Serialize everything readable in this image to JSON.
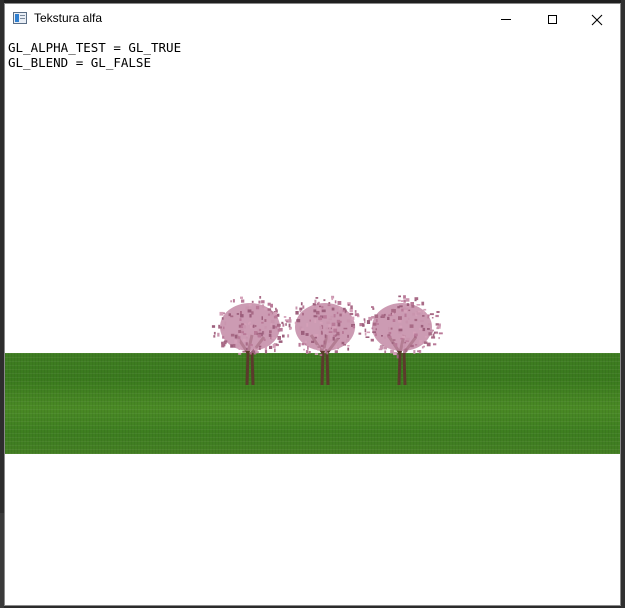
{
  "window": {
    "title": "Tekstura alfa",
    "icon": "app-window-icon",
    "controls": [
      "minimize-icon",
      "maximize-icon",
      "close-icon"
    ]
  },
  "scene": {
    "status_lines": [
      "GL_ALPHA_TEST = GL_TRUE",
      "GL_BLEND = GL_FALSE"
    ],
    "ground_color": "#3f7d22",
    "tree_count": 3,
    "blossom_color": "#c38aa6",
    "trunk_color": "#5b3a2c",
    "background_color": "#ffffff"
  }
}
